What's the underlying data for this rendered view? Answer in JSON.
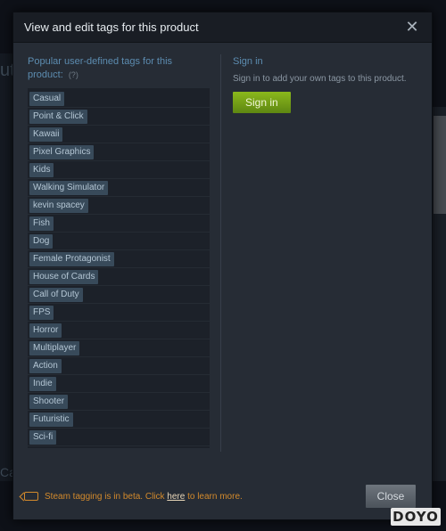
{
  "background": {
    "fragment_top": "ut",
    "fragment_bottom": "Ca"
  },
  "modal": {
    "title": "View and edit tags for this product",
    "close_icon": "close-icon"
  },
  "popular": {
    "heading": "Popular user-defined tags for this product:",
    "help": "(?)",
    "tags": [
      "Casual",
      "Point & Click",
      "Kawaii",
      "Pixel Graphics",
      "Kids",
      "Walking Simulator",
      "kevin spacey",
      "Fish",
      "Dog",
      "Female Protagonist",
      "House of Cards",
      "Call of Duty",
      "FPS",
      "Horror",
      "Multiplayer",
      "Action",
      "Indie",
      "Shooter",
      "Futuristic",
      "Sci-fi"
    ]
  },
  "signin": {
    "heading": "Sign in",
    "text": "Sign in to add your own tags to this product.",
    "button_label": "Sign in"
  },
  "footer": {
    "beta_prefix": "Steam tagging is in beta. Click ",
    "beta_link": "here",
    "beta_suffix": " to learn more.",
    "close_label": "Close"
  },
  "watermark": "DOYO",
  "colors": {
    "accent_blue": "#5c8cb0",
    "signin_green": "#8bb81c",
    "beta_orange": "#d38a2c",
    "tag_bg": "#384a5a"
  }
}
